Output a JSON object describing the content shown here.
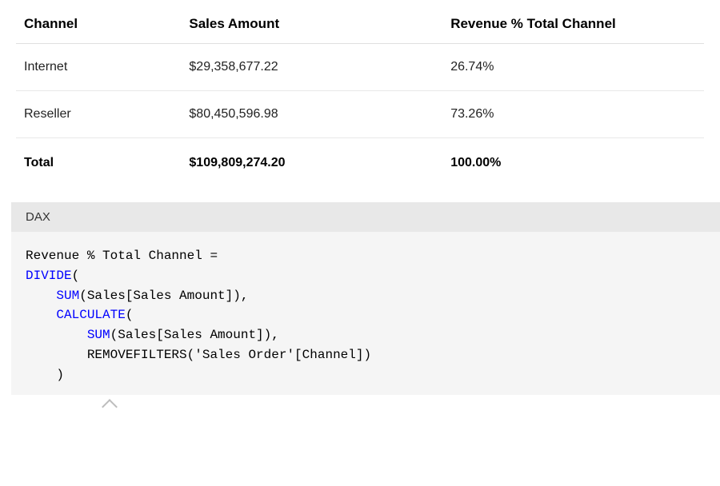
{
  "table": {
    "headers": [
      "Channel",
      "Sales Amount",
      "Revenue % Total Channel"
    ],
    "rows": [
      {
        "channel": "Internet",
        "sales": "$29,358,677.22",
        "pct": "26.74%"
      },
      {
        "channel": "Reseller",
        "sales": "$80,450,596.98",
        "pct": "73.26%"
      }
    ],
    "total": {
      "channel": "Total",
      "sales": "$109,809,274.20",
      "pct": "100.00%"
    }
  },
  "code": {
    "label": "DAX",
    "lines": {
      "l1": "Revenue % Total Channel =",
      "l2a": "DIVIDE",
      "l2b": "(",
      "l3a": "    ",
      "l3b": "SUM",
      "l3c": "(Sales[Sales Amount]),",
      "l4a": "    ",
      "l4b": "CALCULATE",
      "l4c": "(",
      "l5a": "        ",
      "l5b": "SUM",
      "l5c": "(Sales[Sales Amount]),",
      "l6": "        REMOVEFILTERS('Sales Order'[Channel])",
      "l7": "    )"
    }
  }
}
